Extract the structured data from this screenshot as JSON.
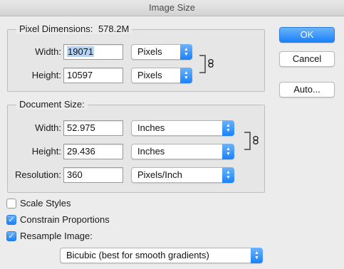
{
  "window": {
    "title": "Image Size"
  },
  "pixel_dimensions": {
    "legend": "Pixel Dimensions:",
    "size": "578.2M",
    "width_label": "Width:",
    "width_value": "19071",
    "width_unit": "Pixels",
    "height_label": "Height:",
    "height_value": "10597",
    "height_unit": "Pixels"
  },
  "document_size": {
    "legend": "Document Size:",
    "width_label": "Width:",
    "width_value": "52.975",
    "width_unit": "Inches",
    "height_label": "Height:",
    "height_value": "29.436",
    "height_unit": "Inches",
    "resolution_label": "Resolution:",
    "resolution_value": "360",
    "resolution_unit": "Pixels/Inch"
  },
  "options": {
    "scale_styles": {
      "label": "Scale Styles",
      "checked": false
    },
    "constrain_proportions": {
      "label": "Constrain Proportions",
      "checked": true
    },
    "resample_image": {
      "label": "Resample Image:",
      "checked": true
    }
  },
  "resample_method": "Bicubic (best for smooth gradients)",
  "buttons": {
    "ok": "OK",
    "cancel": "Cancel",
    "auto": "Auto..."
  },
  "colors": {
    "accent": "#1a82fb",
    "selection": "#b4d4f7"
  }
}
